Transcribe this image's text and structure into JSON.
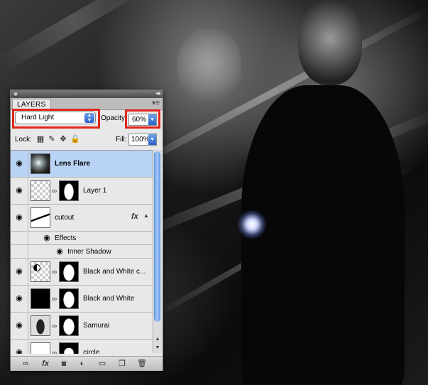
{
  "panel": {
    "tab_label": "LAYERS",
    "collapse_glyph": "◂◂",
    "menu_glyph": "▾≡",
    "blend_mode": "Hard Light",
    "opacity_label": "Opacity:",
    "opacity_value": "60%",
    "lock_label": "Lock:",
    "fill_label": "Fill:",
    "fill_value": "100%"
  },
  "layers": [
    {
      "name": "Lens Flare",
      "selected": true
    },
    {
      "name": "Layer 1"
    },
    {
      "name": "cutout",
      "has_fx": true,
      "fx_glyph": "fx"
    },
    {
      "name": "Black and White c..."
    },
    {
      "name": "Black and White"
    },
    {
      "name": "Samurai"
    },
    {
      "name": "circle"
    }
  ],
  "effects": {
    "group_label": "Effects",
    "items": [
      "Inner Shadow"
    ]
  },
  "icons": {
    "eye": "eye-icon",
    "chain": "chain-link-icon",
    "lock_transparent": "checkerboard-icon",
    "lock_paint": "brush-icon",
    "lock_move": "move-icon",
    "lock_all": "padlock-icon"
  },
  "colors": {
    "selection": "#b8d3f5",
    "highlight_box": "#e0261c",
    "accent_blue": "#2a62c9"
  }
}
